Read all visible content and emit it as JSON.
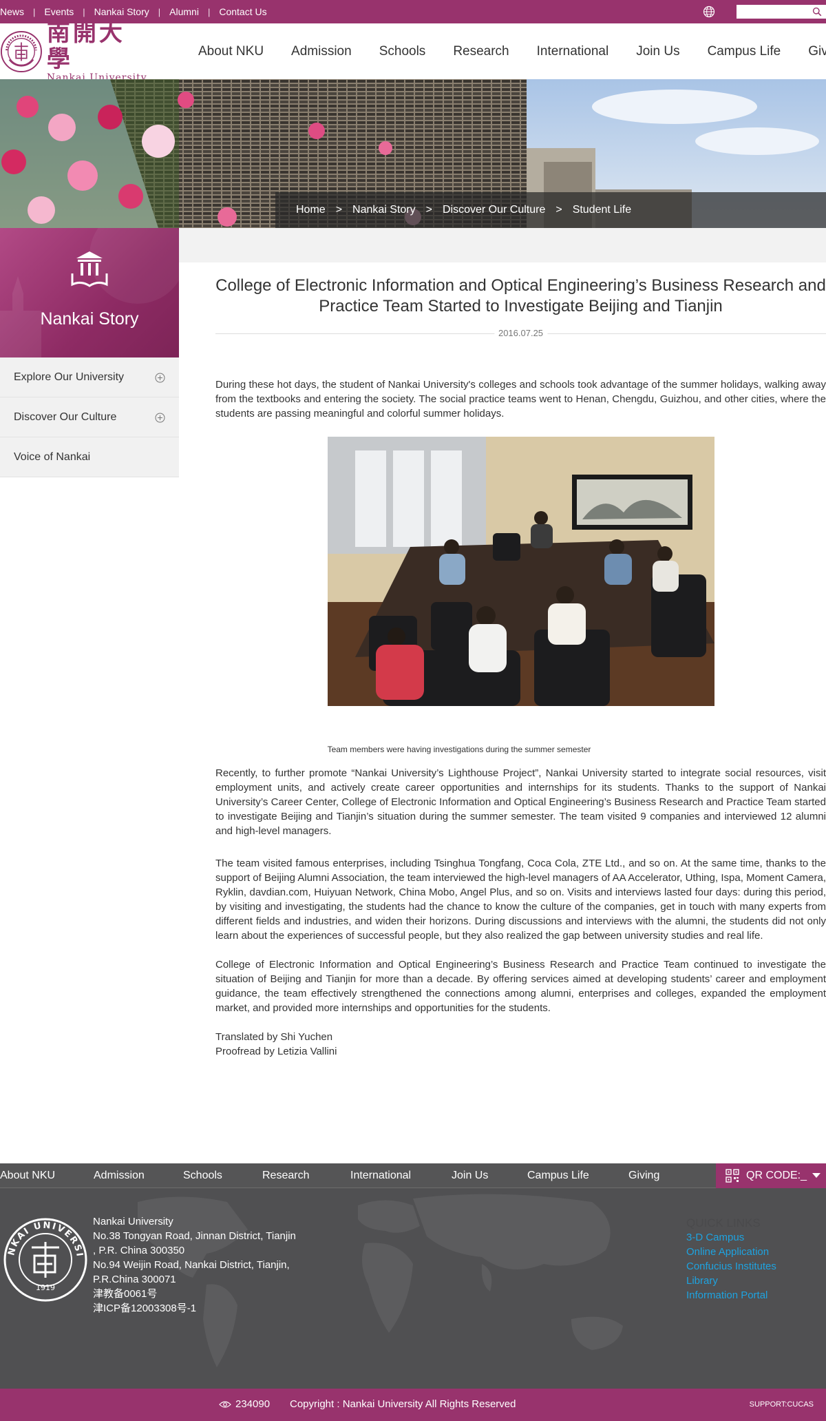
{
  "topbar": {
    "links": [
      "News",
      "Events",
      "Nankai Story",
      "Alumni",
      "Contact Us"
    ],
    "search_placeholder": ""
  },
  "header": {
    "logo_cn": "南開大學",
    "logo_en": "Nankai University",
    "nav": [
      "About NKU",
      "Admission",
      "Schools",
      "Research",
      "International",
      "Join Us",
      "Campus Life",
      "Giving"
    ]
  },
  "breadcrumb": {
    "items": [
      "Home",
      "Nankai Story",
      "Discover Our Culture"
    ],
    "separator": ">",
    "current": "Student Life"
  },
  "sidebar": {
    "title": "Nankai Story",
    "items": [
      {
        "label": "Explore Our University",
        "expandable": true
      },
      {
        "label": "Discover Our Culture",
        "expandable": true
      },
      {
        "label": "Voice of Nankai",
        "expandable": false
      }
    ]
  },
  "article": {
    "title": "College of Electronic Information and Optical Engineering’s Business Research and Practice Team Started to Investigate Beijing and Tianjin",
    "date": "2016.07.25",
    "para1": "During these hot days, the student of Nankai University's colleges and schools took advantage of the summer holidays, walking away from the textbooks and entering the society. The social practice teams went to Henan, Chengdu, Guizhou, and other cities, where the students are passing meaningful and colorful summer holidays.",
    "caption": "Team members were having investigations during the summer semester",
    "para2": "Recently, to further promote “Nankai University’s Lighthouse Project”, Nankai University started to integrate social resources, visit employment units, and actively create career opportunities and internships for its students. Thanks to the support of Nankai University’s Career Center, College of Electronic Information and Optical Engineering’s Business Research and Practice Team started to investigate Beijing and Tianjin’s situation during the summer semester. The team visited 9 companies and interviewed 12 alumni and high-level managers.",
    "para3": "The team visited famous enterprises, including Tsinghua Tongfang, Coca Cola, ZTE Ltd., and so on. At the same time, thanks to the support of Beijing Alumni Association, the team interviewed the high-level managers of AA Accelerator, Uthing, Ispa, Moment Camera, Ryklin, davdian.com, Huiyuan Network, China Mobo, Angel Plus, and so on. Visits and interviews lasted four days: during this period, by visiting and investigating, the students had the chance to know the culture of the companies, get in touch with many experts from different fields and industries, and widen their horizons. During discussions and interviews with the alumni, the students did not only learn about the experiences of successful people, but they also realized the gap between university studies and real life.",
    "para4": "College of Electronic Information and Optical Engineering’s Business Research and Practice Team continued to investigate the situation of Beijing and Tianjin for more than a decade. By offering services aimed at developing students’ career and employment guidance, the team effectively strengthened the connections among alumni, enterprises and colleges, expanded the employment market, and provided more internships and opportunities for the students.",
    "translated": "Translated by Shi Yuchen",
    "proofread": "Proofread by Letizia Vallini"
  },
  "footer": {
    "nav": [
      "About NKU",
      "Admission",
      "Schools",
      "Research",
      "International",
      "Join Us",
      "Campus Life",
      "Giving"
    ],
    "qr_label": "QR CODE:_",
    "address_lines": [
      "Nankai University",
      "No.38 Tongyan Road, Jinnan District, Tianjin",
      ", P.R. China 300350",
      "No.94 Weijin Road,  Nankai District, Tianjin,",
      "P.R.China  300071",
      "津教备0061号",
      "津ICP备12003308号-1"
    ],
    "quick_title": "QUICK LINKS",
    "quick_links": [
      "3-D Campus",
      "Online Application",
      "Confucius Institutes",
      "Library",
      "Information Portal"
    ],
    "visits": "234090",
    "copyright": "Copyright : Nankai University All Rights Reserved",
    "support": "SUPPORT:CUCAS",
    "seal_text": "NANKAI UNIVERSITY",
    "seal_year": "1919"
  },
  "colors": {
    "brand": "#98336d",
    "footer_bg": "#505052",
    "link_blue": "#1ea3e0"
  }
}
